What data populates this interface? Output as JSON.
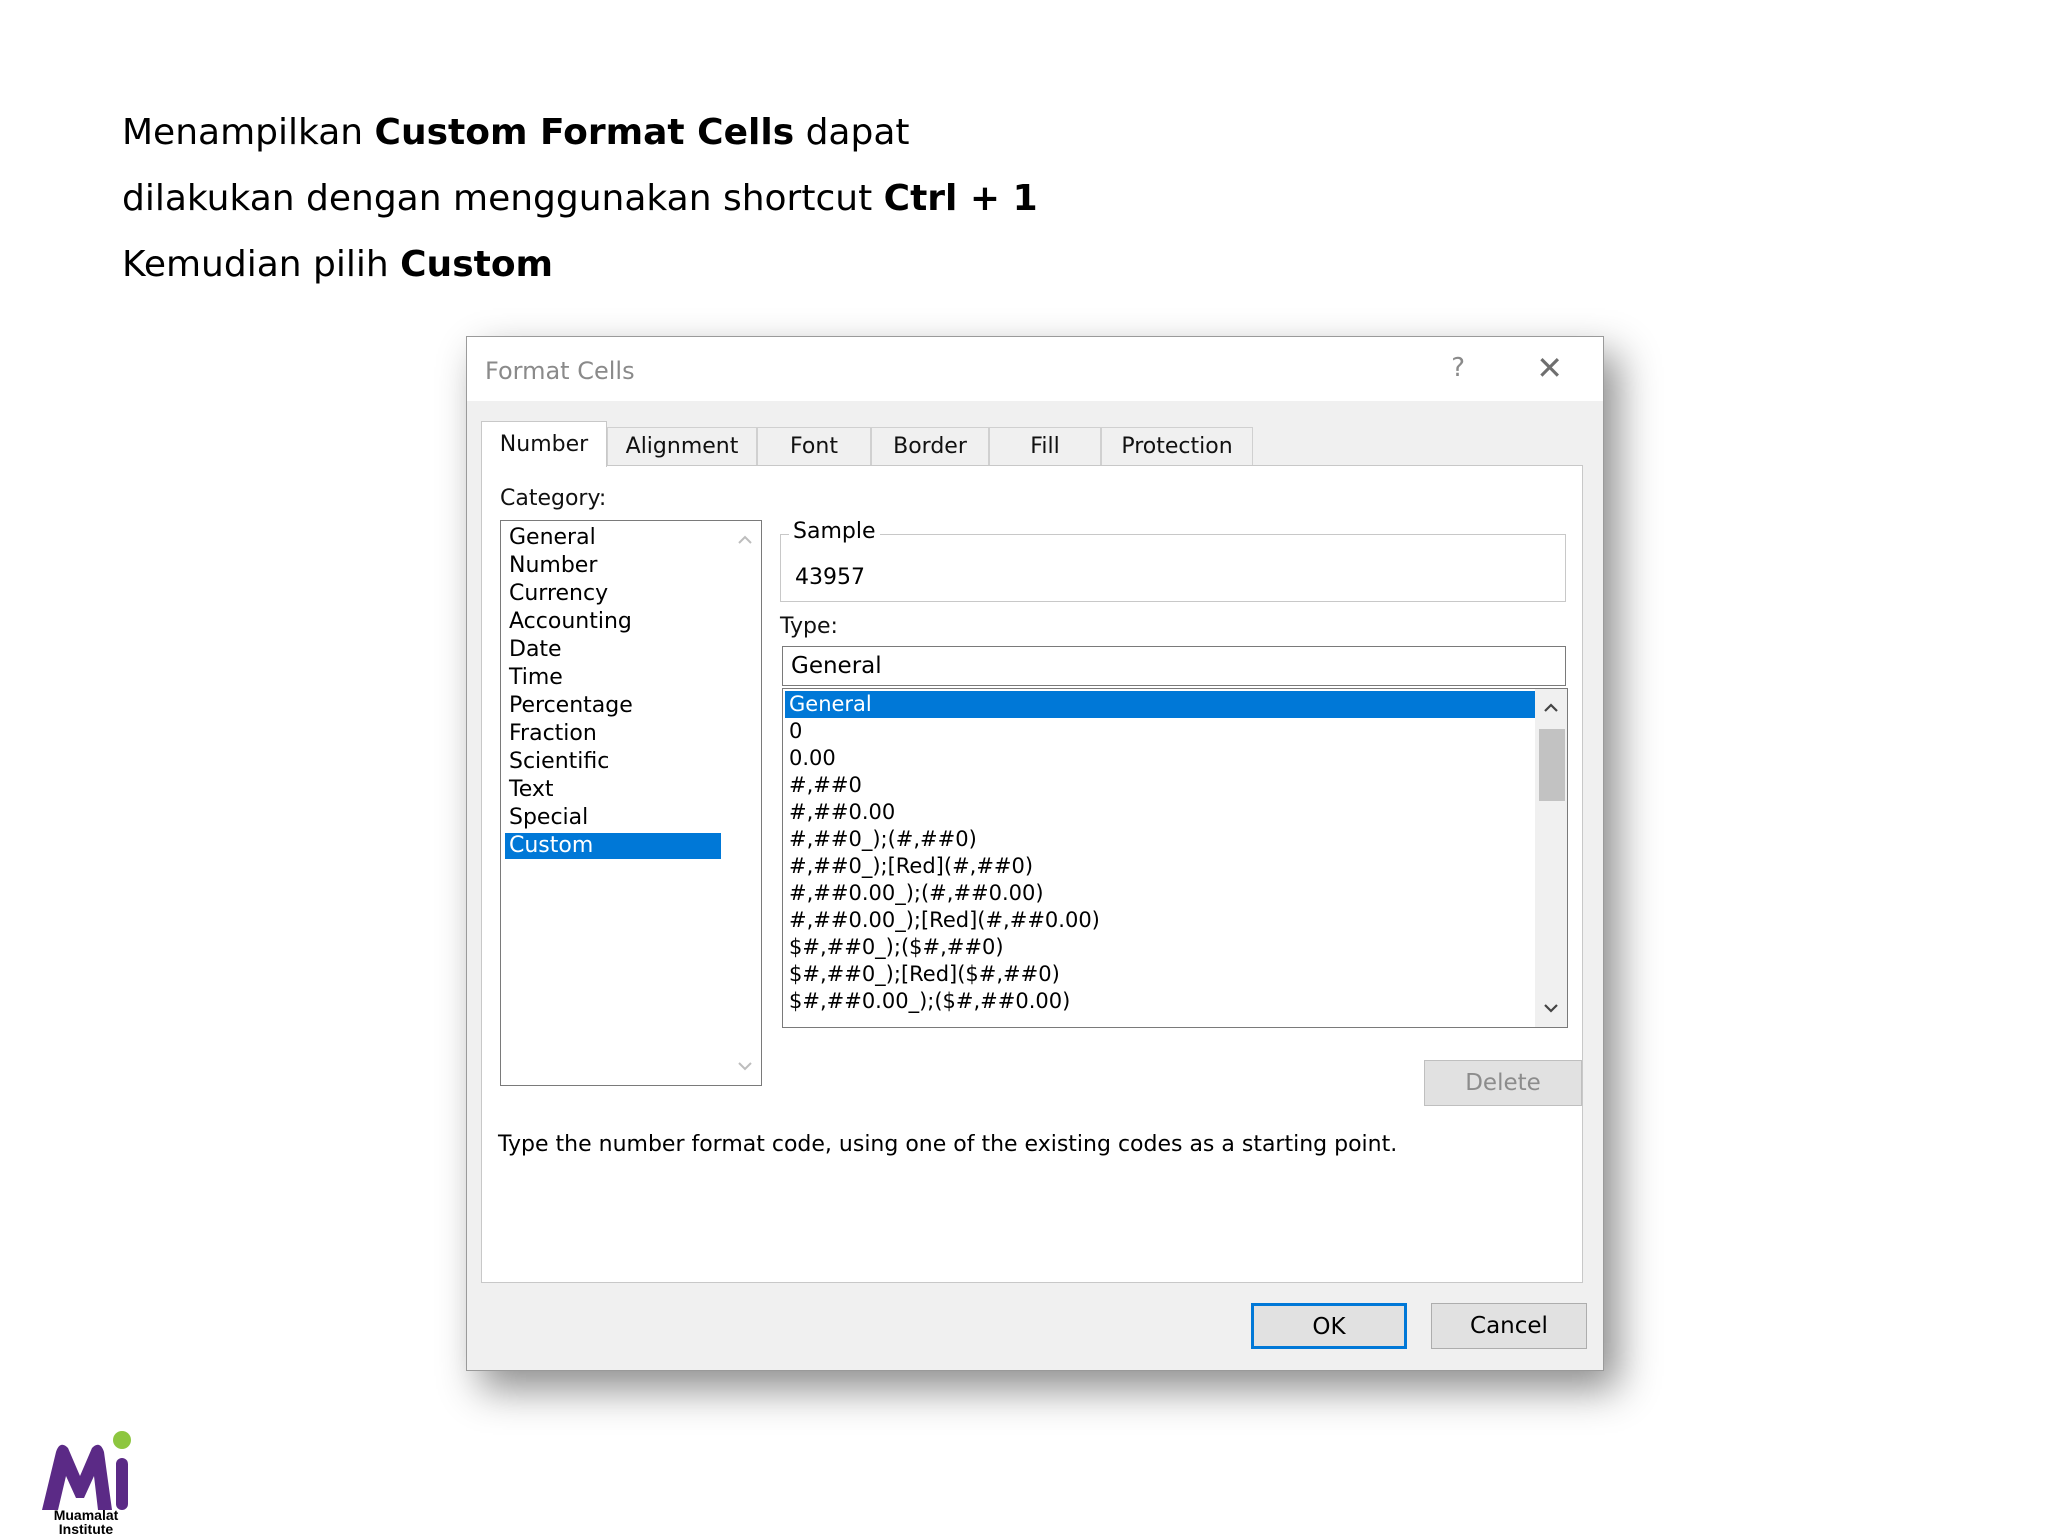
{
  "intro": {
    "line1_pre": "Menampilkan ",
    "line1_bold": "Custom Format Cells",
    "line1_post": " dapat",
    "line2_pre": "dilakukan dengan menggunakan shortcut ",
    "line2_bold": "Ctrl + 1",
    "line3_pre": "Kemudian pilih ",
    "line3_bold": "Custom"
  },
  "dialog": {
    "title": "Format Cells",
    "help": "?",
    "close": "✕",
    "tabs": [
      "Number",
      "Alignment",
      "Font",
      "Border",
      "Fill",
      "Protection"
    ],
    "active_tab": "Number",
    "category_label": "Category:",
    "categories": [
      "General",
      "Number",
      "Currency",
      "Accounting",
      "Date",
      "Time",
      "Percentage",
      "Fraction",
      "Scientific",
      "Text",
      "Special",
      "Custom"
    ],
    "selected_category": "Custom",
    "sample_label": "Sample",
    "sample_value": "43957",
    "type_label": "Type:",
    "type_value": "General",
    "type_list": [
      "General",
      "0",
      "0.00",
      "#,##0",
      "#,##0.00",
      "#,##0_);(#,##0)",
      "#,##0_);[Red](#,##0)",
      "#,##0.00_);(#,##0.00)",
      "#,##0.00_);[Red](#,##0.00)",
      "$#,##0_);($#,##0)",
      "$#,##0_);[Red]($#,##0)",
      "$#,##0.00_);($#,##0.00)"
    ],
    "selected_type": "General",
    "delete_label": "Delete",
    "description": "Type the number format code, using one of the existing codes as a starting point.",
    "ok_label": "OK",
    "cancel_label": "Cancel"
  },
  "logo": {
    "line1": "Muamalat",
    "line2": "Institute",
    "colors": {
      "primary": "#5b2a86",
      "accent": "#8dc63f"
    }
  },
  "colors": {
    "selection": "#0078d7",
    "dialog_bg": "#f0f0f0"
  }
}
